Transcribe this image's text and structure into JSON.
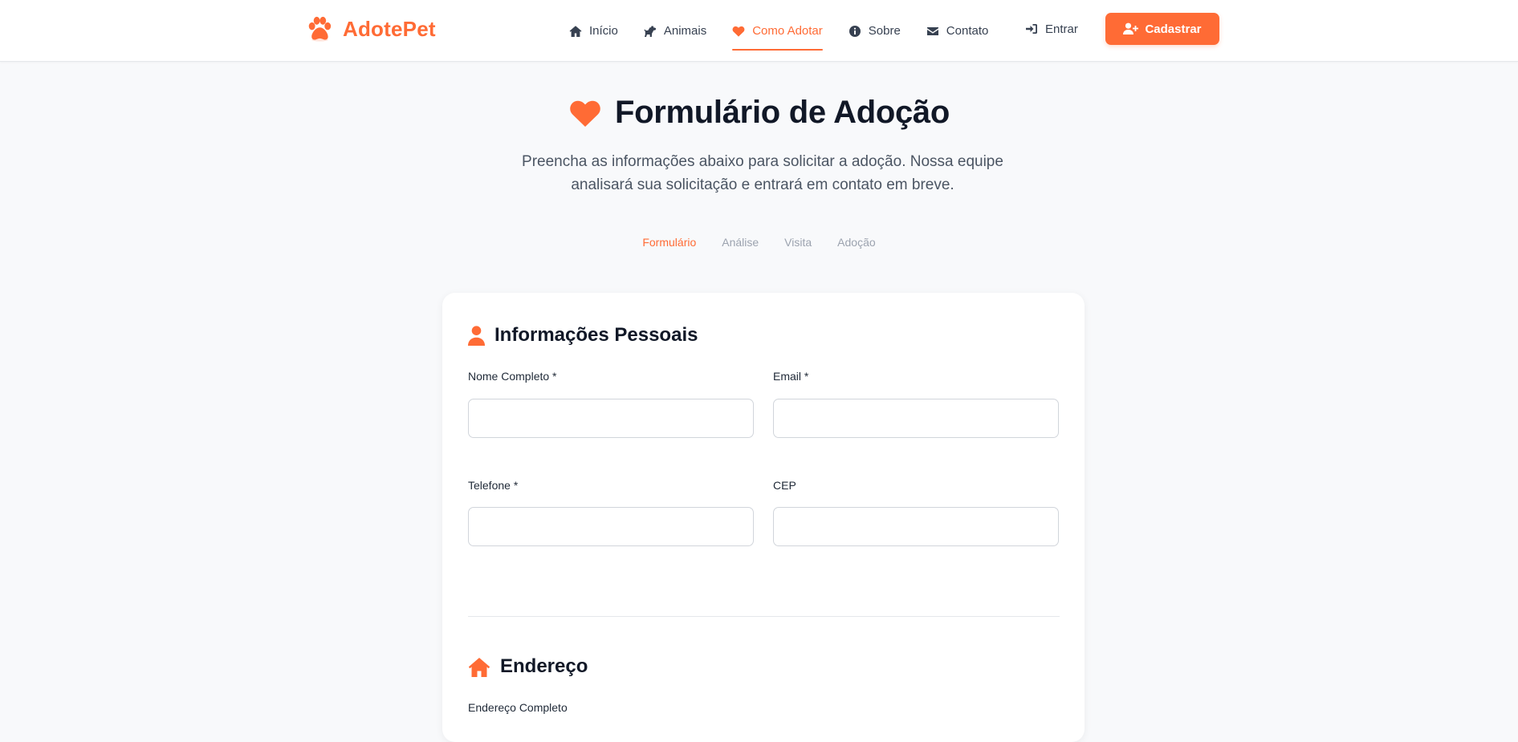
{
  "brand": {
    "name": "AdotePet",
    "icon": "paw-icon",
    "color": "#ff6b35"
  },
  "nav": {
    "items": [
      {
        "label": "Início",
        "icon": "home-icon"
      },
      {
        "label": "Animais",
        "icon": "dog-icon"
      },
      {
        "label": "Como Adotar",
        "icon": "heart-icon",
        "active": true
      },
      {
        "label": "Sobre",
        "icon": "info-icon"
      },
      {
        "label": "Contato",
        "icon": "envelope-icon"
      }
    ],
    "login_label": "Entrar",
    "signup_label": "Cadastrar"
  },
  "hero": {
    "title": "Formulário de Adoção",
    "subtitle": "Preencha as informações abaixo para solicitar a adoção. Nossa equipe analisará sua solicitação e entrará em contato em breve."
  },
  "steps": [
    {
      "label": "Formulário",
      "active": true
    },
    {
      "label": "Análise"
    },
    {
      "label": "Visita"
    },
    {
      "label": "Adoção"
    }
  ],
  "form": {
    "personal": {
      "title": "Informações Pessoais",
      "fields": [
        {
          "label": "Nome Completo *",
          "value": ""
        },
        {
          "label": "Email *",
          "value": ""
        },
        {
          "label": "Telefone *",
          "value": ""
        },
        {
          "label": "CEP",
          "value": ""
        }
      ]
    },
    "address": {
      "title": "Endereço",
      "fields": [
        {
          "label": "Endereço Completo",
          "value": ""
        }
      ]
    }
  },
  "colors": {
    "accent": "#ff6b35",
    "text_dark": "#111827",
    "text_muted": "#4b5563",
    "inactive_step": "#9ca3af",
    "background": "#f8f9fb"
  }
}
